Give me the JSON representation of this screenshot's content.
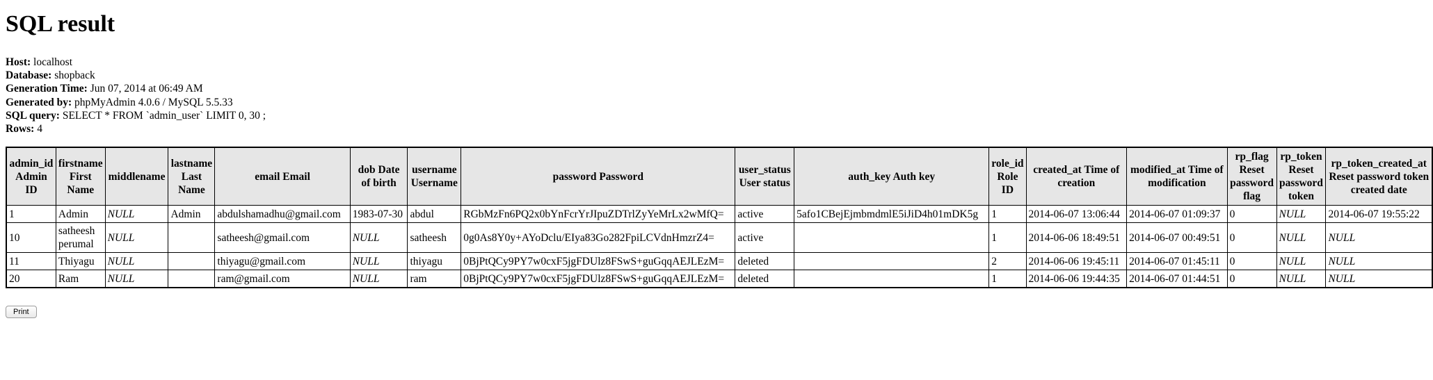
{
  "title": "SQL result",
  "meta": {
    "host_label": "Host:",
    "host": "localhost",
    "database_label": "Database:",
    "database": "shopback",
    "generation_time_label": "Generation Time:",
    "generation_time": "Jun 07, 2014 at 06:49 AM",
    "generated_by_label": "Generated by:",
    "generated_by": "phpMyAdmin 4.0.6 / MySQL 5.5.33",
    "sql_query_label": "SQL query:",
    "sql_query": "SELECT * FROM `admin_user` LIMIT 0, 30 ;",
    "rows_label": "Rows:",
    "rows": "4"
  },
  "table": {
    "headers": [
      "admin_id Admin ID",
      "firstname First Name",
      "middlename",
      "lastname Last Name",
      "email Email",
      "dob Date of birth",
      "username Username",
      "password Password",
      "user_status User status",
      "auth_key Auth key",
      "role_id Role ID",
      "created_at Time of creation",
      "modified_at Time of modification",
      "rp_flag Reset password flag",
      "rp_token Reset password token",
      "rp_token_created_at Reset password token created date"
    ],
    "rows": [
      [
        "1",
        "Admin",
        "NULL",
        "Admin",
        "abdulshamadhu@gmail.com",
        "1983-07-30",
        "abdul",
        "RGbMzFn6PQ2x0bYnFcrYrJIpuZDTrlZyYeMrLx2wMfQ=",
        "active",
        "5afo1CBejEjmbmdmlE5iJiD4h01mDK5g",
        "1",
        "2014-06-07 13:06:44",
        "2014-06-07 01:09:37",
        "0",
        "NULL",
        "2014-06-07 19:55:22"
      ],
      [
        "10",
        "satheesh perumal",
        "NULL",
        "",
        "satheesh@gmail.com",
        "NULL",
        "satheesh",
        "0g0As8Y0y+AYoDclu/EIya83Go282FpiLCVdnHmzrZ4=",
        "active",
        "",
        "1",
        "2014-06-06 18:49:51",
        "2014-06-07 00:49:51",
        "0",
        "NULL",
        "NULL"
      ],
      [
        "11",
        "Thiyagu",
        "NULL",
        "",
        "thiyagu@gmail.com",
        "NULL",
        "thiyagu",
        "0BjPtQCy9PY7w0cxF5jgFDUlz8FSwS+guGqqAEJLEzM=",
        "deleted",
        "",
        "2",
        "2014-06-06 19:45:11",
        "2014-06-07 01:45:11",
        "0",
        "NULL",
        "NULL"
      ],
      [
        "20",
        "Ram",
        "NULL",
        "",
        "ram@gmail.com",
        "NULL",
        "ram",
        "0BjPtQCy9PY7w0cxF5jgFDUlz8FSwS+guGqqAEJLEzM=",
        "deleted",
        "",
        "1",
        "2014-06-06 19:44:35",
        "2014-06-07 01:44:51",
        "0",
        "NULL",
        "NULL"
      ]
    ]
  },
  "print_button": "Print"
}
